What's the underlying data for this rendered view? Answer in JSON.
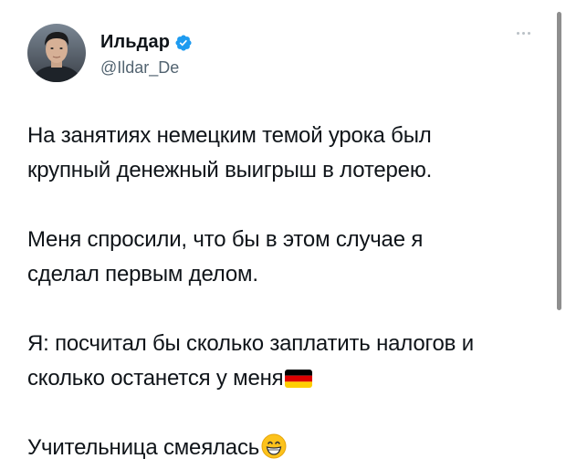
{
  "author": {
    "display_name": "Ильдар",
    "handle": "@Ildar_De",
    "verified": true,
    "avatar_icon": "profile-photo"
  },
  "menu": {
    "icon": "more-horizontal-icon"
  },
  "tweet": {
    "lines": [
      "На занятиях немецким темой урока был",
      "крупный денежный выигрыш в лотерею.",
      "Меня спросили, что бы в этом случае я",
      "сделал первым делом.",
      "Я: посчитал бы сколько заплатить налогов и",
      "сколько останется у меня",
      "Учительница смеялась"
    ],
    "emojis": {
      "flag": "germany-flag-emoji",
      "smile": "grinning-face-emoji"
    }
  },
  "colors": {
    "text": "#0f1419",
    "secondary": "#536471",
    "verified": "#1d9bf0"
  }
}
